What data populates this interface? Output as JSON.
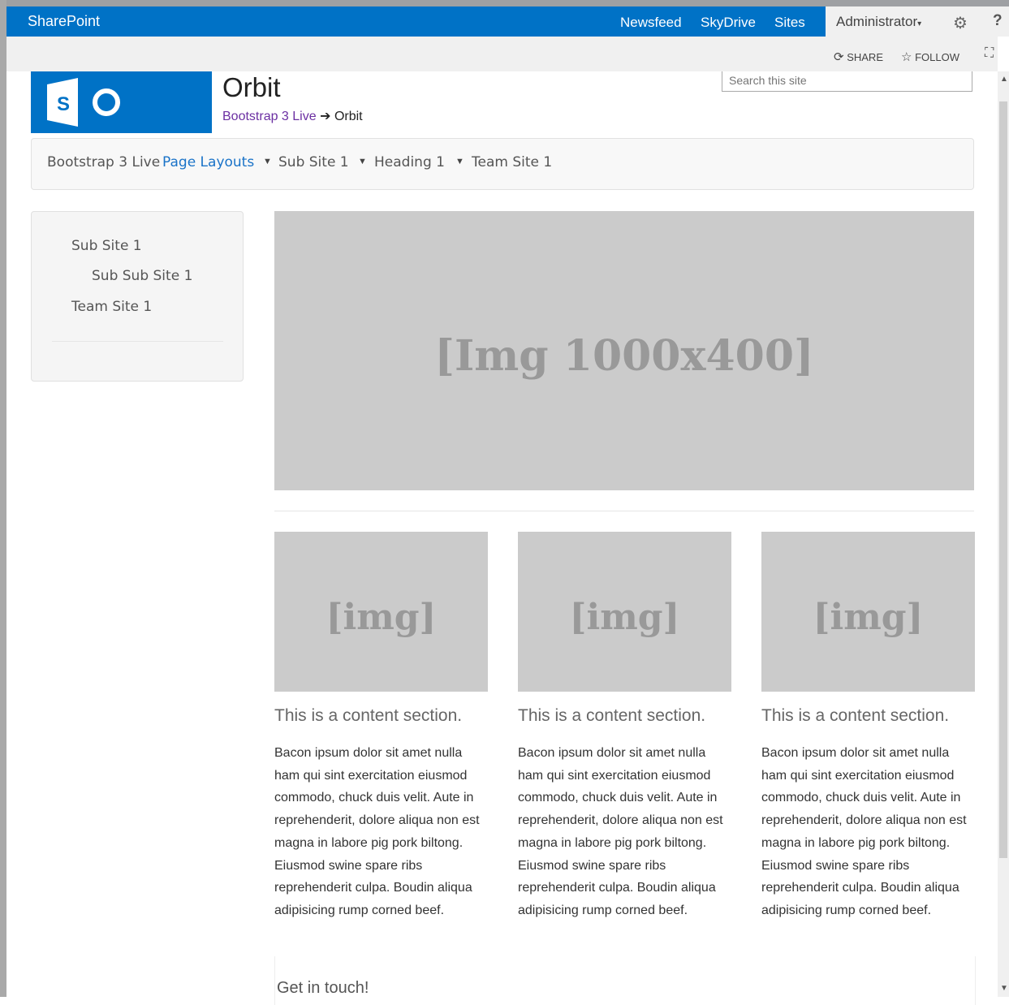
{
  "suitebar": {
    "brand": "SharePoint",
    "links": [
      "Newsfeed",
      "SkyDrive",
      "Sites"
    ],
    "user": "Administrator",
    "help": "?"
  },
  "ribbon": {
    "share": "SHARE",
    "follow": "FOLLOW"
  },
  "site": {
    "title": "Orbit",
    "breadcrumb_parent": "Bootstrap 3 Live",
    "breadcrumb_current": "Orbit",
    "search_placeholder": "Search this site"
  },
  "topnav": [
    "Bootstrap 3 Live",
    "Page Layouts",
    "Sub Site 1",
    "Heading 1",
    "Team Site 1"
  ],
  "leftnav": [
    "Sub Site 1",
    "Sub Sub Site 1",
    "Team Site 1"
  ],
  "hero": {
    "label": "[Img 1000x400]"
  },
  "columns": [
    {
      "img": "[img]",
      "heading": "This is a content section.",
      "body": "Bacon ipsum dolor sit amet nulla ham qui sint exercitation eiusmod commodo, chuck duis velit. Aute in reprehenderit, dolore aliqua non est magna in labore pig pork biltong. Eiusmod swine spare ribs reprehenderit culpa. Boudin aliqua adipisicing rump corned beef."
    },
    {
      "img": "[img]",
      "heading": "This is a content section.",
      "body": "Bacon ipsum dolor sit amet nulla ham qui sint exercitation eiusmod commodo, chuck duis velit. Aute in reprehenderit, dolore aliqua non est magna in labore pig pork biltong. Eiusmod swine spare ribs reprehenderit culpa. Boudin aliqua adipisicing rump corned beef."
    },
    {
      "img": "[img]",
      "heading": "This is a content section.",
      "body": "Bacon ipsum dolor sit amet nulla ham qui sint exercitation eiusmod commodo, chuck duis velit. Aute in reprehenderit, dolore aliqua non est magna in labore pig pork biltong. Eiusmod swine spare ribs reprehenderit culpa. Boudin aliqua adipisicing rump corned beef."
    }
  ],
  "contact": {
    "heading": "Get in touch!"
  },
  "icons": [
    "sharepoint-logo-icon",
    "gear-icon",
    "help-icon",
    "share-icon",
    "star-icon",
    "focus-icon",
    "caret-down-icon"
  ],
  "colors": {
    "suitebar": "#0072c6",
    "link_active": "#1a73c8",
    "breadcrumb_link": "#6b2fa2",
    "placeholder_bg": "#cbcbcb"
  }
}
